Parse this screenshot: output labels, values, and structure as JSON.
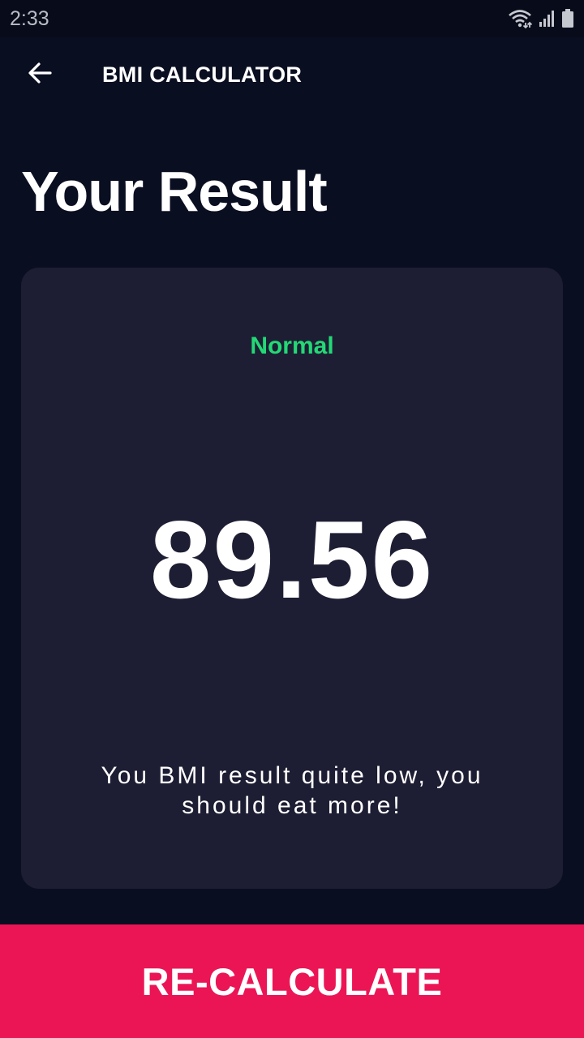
{
  "status_bar": {
    "time": "2:33",
    "icons": [
      "wifi-icon",
      "signal-icon",
      "battery-icon"
    ]
  },
  "app_bar": {
    "title": "BMI CALCULATOR",
    "back_icon": "arrow-back-icon"
  },
  "page": {
    "title": "Your Result"
  },
  "result": {
    "category": "Normal",
    "value": "89.56",
    "message": "You BMI result quite low, you should eat more!"
  },
  "actions": {
    "recalculate_label": "RE-CALCULATE"
  },
  "colors": {
    "background": "#0a0e21",
    "card": "#1d1e33",
    "category_text": "#24d876",
    "button": "#eb1555"
  }
}
